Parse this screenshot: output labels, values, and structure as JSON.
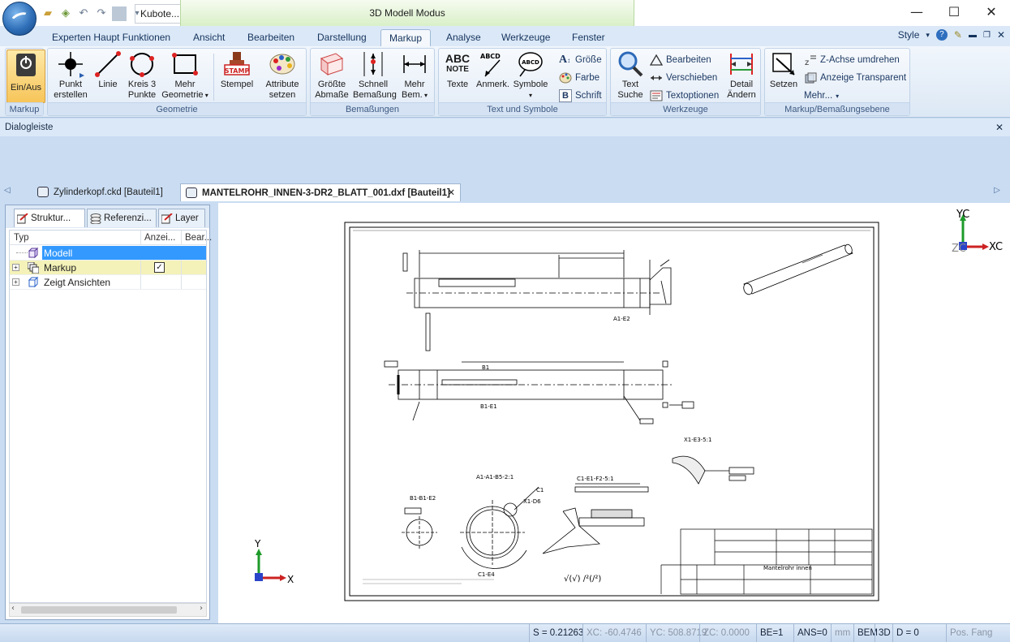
{
  "title_bar": {
    "file_title": "Kubote...",
    "mode": "3D Modell Modus"
  },
  "ribbon_tabs": [
    "Experten Haupt Funktionen",
    "Ansicht",
    "Bearbeiten",
    "Darstellung",
    "Markup",
    "Analyse",
    "Werkzeuge",
    "Fenster"
  ],
  "active_tab": "Markup",
  "style_menu": "Style",
  "groups": {
    "markup": {
      "label": "Markup",
      "ein_aus": "Ein/Aus"
    },
    "geometrie": {
      "label": "Geometrie",
      "punkt": [
        "Punkt",
        "erstellen"
      ],
      "linie": "Linie",
      "kreis": [
        "Kreis 3",
        "Punkte"
      ],
      "mehr": [
        "Mehr",
        "Geometrie"
      ],
      "stempel": "Stempel",
      "attribute": [
        "Attribute",
        "setzen"
      ]
    },
    "bemassungen": {
      "label": "Bemaßungen",
      "groesste": [
        "Größte",
        "Abmaße"
      ],
      "schnell": [
        "Schnell",
        "Bemaßung"
      ],
      "mehr": [
        "Mehr",
        "Bem."
      ]
    },
    "text": {
      "label": "Text und Symbole",
      "texte": "Texte",
      "anmerk": "Anmerk.",
      "symbole": "Symbole",
      "groesse": "Größe",
      "farbe": "Farbe",
      "schrift": "Schrift",
      "abc_note": [
        "ABC",
        "NOTE"
      ]
    },
    "werkzeuge": {
      "label": "Werkzeuge",
      "text_suche": [
        "Text",
        "Suche"
      ],
      "bearbeiten": "Bearbeiten",
      "verschieben": "Verschieben",
      "textoptionen": "Textoptionen",
      "detail": [
        "Detail",
        "Ändern"
      ]
    },
    "ebene": {
      "label": "Markup/Bemaßungsebene",
      "setzen": "Setzen",
      "z_achse": "Z-Achse umdrehen",
      "transparent": "Anzeige Transparent",
      "mehr": "Mehr..."
    }
  },
  "dialog_bar": "Dialogleiste",
  "doc_tabs": [
    {
      "label": "Zylinderkopf.ckd [Bauteil1]",
      "active": false
    },
    {
      "label": "MANTELROHR_INNEN-3-DR2_BLATT_001.dxf [Bauteil1]",
      "active": true
    }
  ],
  "panel_tabs": [
    "Struktur...",
    "Referenzi...",
    "Layer"
  ],
  "tree": {
    "headers": [
      "Typ",
      "Anzei...",
      "Bear..."
    ],
    "rows": [
      {
        "label": "Modell",
        "selected": true
      },
      {
        "label": "Markup",
        "checked": true
      },
      {
        "label": "Zeigt Ansichten"
      }
    ]
  },
  "axes": {
    "triad_top": [
      "YC",
      "ZC",
      "XC"
    ],
    "triad_bottom": [
      "Y",
      "X"
    ]
  },
  "status": {
    "scale": "S = 0.21263",
    "xc": "XC: -60.4746",
    "yc": "YC: 508.8719",
    "zc": "ZC: 0.0000",
    "be": "BE=1",
    "ans": "ANS=0",
    "mm": "mm",
    "bem": "BEM",
    "mode3d": "3D",
    "d": "D = 0",
    "pos": "Pos. Fang"
  },
  "drawing_labels": {
    "a1_e2": "A1-E2",
    "b1": "B1",
    "b1_e1": "B1-E1",
    "b1_b1_e2": "B1-B1-E2",
    "a1_a1": "A1-A1-B5-2:1",
    "c1_e1": "C1-E1-F2-5:1",
    "x1_e3": "X1-E3-5:1",
    "c1e4": "C1-E4",
    "x1d6": "X1-D6",
    "c1": "C1",
    "mantel": "Mantelrohr  innen",
    "roughness": "√(√)   ∕²(∕²)"
  },
  "colors": {
    "selection": "#3399ff",
    "markup_row": "#f4f2b8",
    "ribbon_bg": "#dce8f5",
    "modus": "#d9f0c8"
  }
}
